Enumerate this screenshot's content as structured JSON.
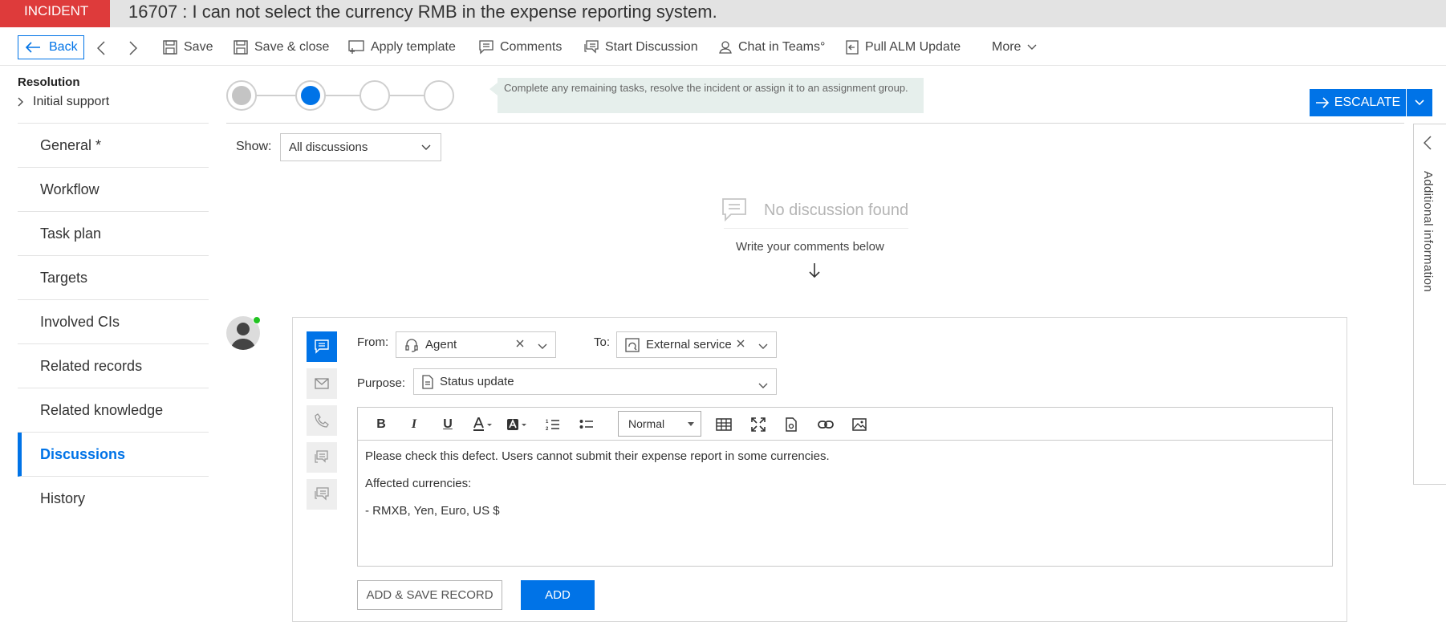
{
  "header": {
    "badge": "INCIDENT",
    "title": "16707 : I can not select the currency RMB in the expense reporting system."
  },
  "toolbar": {
    "back": "Back",
    "save": "Save",
    "save_close": "Save & close",
    "apply_template": "Apply template",
    "comments": "Comments",
    "start_discussion": "Start Discussion",
    "chat_teams": "Chat in Teams°",
    "pull_alm": "Pull ALM Update",
    "more": "More"
  },
  "phase": {
    "title": "Resolution",
    "subtitle": "Initial support",
    "hint": "Complete any remaining tasks, resolve the incident or assign it to an assignment group.",
    "steps": [
      {
        "state": "done"
      },
      {
        "state": "current"
      },
      {
        "state": "pending"
      },
      {
        "state": "pending"
      }
    ]
  },
  "escalate": {
    "label": "ESCALATE"
  },
  "nav": {
    "items": [
      {
        "label": "General *",
        "active": false
      },
      {
        "label": "Workflow",
        "active": false
      },
      {
        "label": "Task plan",
        "active": false
      },
      {
        "label": "Targets",
        "active": false
      },
      {
        "label": "Involved CIs",
        "active": false
      },
      {
        "label": "Related records",
        "active": false
      },
      {
        "label": "Related knowledge",
        "active": false
      },
      {
        "label": "Discussions",
        "active": true
      },
      {
        "label": "History",
        "active": false
      }
    ]
  },
  "side_panel": {
    "label": "Additional information"
  },
  "discussions": {
    "show_label": "Show:",
    "filter_value": "All discussions",
    "empty_title": "No discussion found",
    "empty_hint": "Write your comments below"
  },
  "compose": {
    "from_label": "From:",
    "from_value": "Agent",
    "to_label": "To:",
    "to_value": "External service",
    "purpose_label": "Purpose:",
    "purpose_value": "Status update",
    "format_value": "Normal",
    "body": [
      "Please check this defect. Users cannot submit their expense report in some currencies.",
      "Affected currencies:",
      "- RMXB, Yen, Euro, US $"
    ],
    "add_save_label": "ADD & SAVE RECORD",
    "add_label": "ADD"
  },
  "colors": {
    "accent": "#0073e7",
    "incident_red": "#de3b3b",
    "online": "#22c322"
  }
}
